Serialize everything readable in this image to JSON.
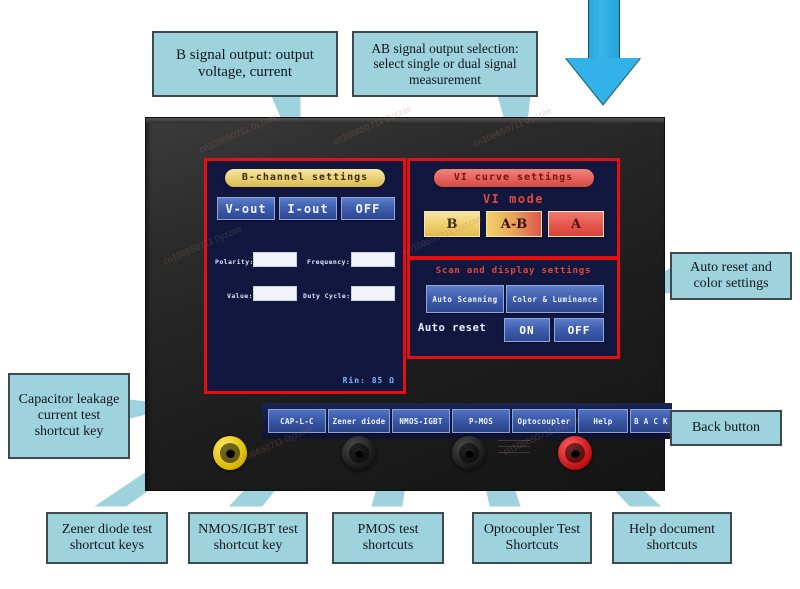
{
  "device": {
    "screen": {
      "left_panel": {
        "title": "B-channel settings",
        "buttons": [
          {
            "name": "v-out",
            "label": "V-out"
          },
          {
            "name": "i-out",
            "label": "I-out"
          },
          {
            "name": "off",
            "label": "OFF"
          }
        ],
        "fields": [
          {
            "name": "polarity",
            "label": "Polarity:",
            "value": ""
          },
          {
            "name": "frequency",
            "label": "Frequency:",
            "value": ""
          },
          {
            "name": "value",
            "label": "Value:",
            "value": ""
          },
          {
            "name": "duty-cycle",
            "label": "Duty Cycle:",
            "value": ""
          }
        ],
        "rin": "Rin: 85 Ω"
      },
      "vi_panel": {
        "title": "VI curve settings",
        "mode_label": "VI mode",
        "modes": [
          {
            "name": "b",
            "label": "B"
          },
          {
            "name": "a-b",
            "label": "A-B"
          },
          {
            "name": "a",
            "label": "A"
          }
        ]
      },
      "scan_panel": {
        "title": "Scan and display settings",
        "buttons": [
          {
            "name": "auto-scanning",
            "label": "Auto Scanning"
          },
          {
            "name": "color-luminance",
            "label": "Color & Luminance"
          }
        ],
        "auto_reset_label": "Auto reset",
        "auto_reset_options": [
          {
            "name": "on",
            "label": "ON"
          },
          {
            "name": "off",
            "label": "OFF"
          }
        ]
      },
      "shortcuts": [
        {
          "name": "cap-l-c",
          "label": "CAP-L-C"
        },
        {
          "name": "zener-diode",
          "label": "Zener diode"
        },
        {
          "name": "nmos-igbt",
          "label": "NMOS-IGBT"
        },
        {
          "name": "p-mos",
          "label": "P-MOS"
        },
        {
          "name": "optocoupler",
          "label": "Optocoupler"
        },
        {
          "name": "help",
          "label": "Help"
        },
        {
          "name": "back",
          "label": "B A C K"
        }
      ]
    },
    "terminals": [
      {
        "name": "terminal-yellow",
        "color": "#e8c400"
      },
      {
        "name": "terminal-black-1",
        "color": "#1a1a1a"
      },
      {
        "name": "terminal-black-2",
        "color": "#1a1a1a"
      },
      {
        "name": "terminal-red",
        "color": "#c2131a"
      }
    ]
  },
  "callouts": [
    {
      "name": "callout-b-signal-output",
      "text": "B signal output:\noutput voltage, current"
    },
    {
      "name": "callout-ab-signal-selection",
      "text": "AB signal output selection:\nselect single or dual signal measurement"
    },
    {
      "name": "callout-auto-reset-color",
      "text": "Auto reset and color settings"
    },
    {
      "name": "callout-back-button",
      "text": "Back button"
    },
    {
      "name": "callout-capacitor-leakage",
      "text": "Capacitor leakage current test shortcut key"
    },
    {
      "name": "callout-zener-diode",
      "text": "Zener diode test shortcut keys"
    },
    {
      "name": "callout-nmos-igbt",
      "text": "NMOS/IGBT test shortcut key"
    },
    {
      "name": "callout-pmos",
      "text": "PMOS test shortcuts"
    },
    {
      "name": "callout-optocoupler",
      "text": "Optocoupler Test Shortcuts"
    },
    {
      "name": "callout-help-document",
      "text": "Help document shortcuts"
    }
  ],
  "colors": {
    "callout_fill": "#9ed3dd",
    "callout_border": "#3d4a4d",
    "panel_border_red": "#e50f0f",
    "screen_bg": "#11173f",
    "arrow_blue": "#32b2e6"
  },
  "watermark": "cn108650711 0yzzae"
}
